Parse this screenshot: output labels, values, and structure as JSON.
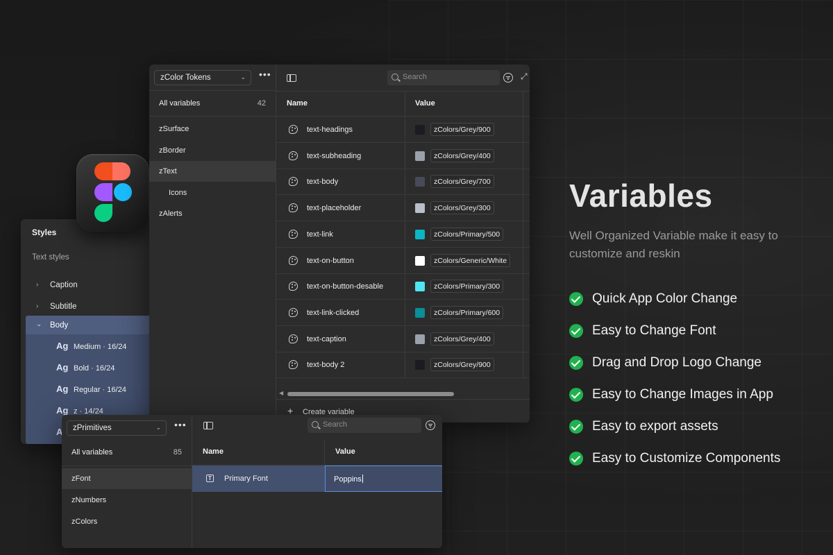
{
  "main_panel": {
    "collection": "zColor Tokens",
    "all_variables_label": "All variables",
    "all_variables_count": "42",
    "groups": [
      {
        "label": "zSurface",
        "active": false,
        "sub": false
      },
      {
        "label": "zBorder",
        "active": false,
        "sub": false
      },
      {
        "label": "zText",
        "active": true,
        "sub": false
      },
      {
        "label": "Icons",
        "active": false,
        "sub": true
      },
      {
        "label": "zAlerts",
        "active": false,
        "sub": false
      }
    ],
    "search_placeholder": "Search",
    "columns": {
      "name": "Name",
      "value": "Value"
    },
    "variables": [
      {
        "name": "text-headings",
        "swatch": "#1b1b22",
        "alias": "zColors/Grey/900"
      },
      {
        "name": "text-subheading",
        "swatch": "#9aa1ad",
        "alias": "zColors/Grey/400"
      },
      {
        "name": "text-body",
        "swatch": "#474b57",
        "alias": "zColors/Grey/700"
      },
      {
        "name": "text-placeholder",
        "swatch": "#b9bec8",
        "alias": "zColors/Grey/300"
      },
      {
        "name": "text-link",
        "swatch": "#0cb5c4",
        "alias": "zColors/Primary/500"
      },
      {
        "name": "text-on-button",
        "swatch": "#ffffff",
        "alias": "zColors/Generic/White"
      },
      {
        "name": "text-on-button-desable",
        "swatch": "#4fe6f3",
        "alias": "zColors/Primary/300"
      },
      {
        "name": "text-link-clicked",
        "swatch": "#0a8e97",
        "alias": "zColors/Primary/600"
      },
      {
        "name": "text-caption",
        "swatch": "#9aa1ad",
        "alias": "zColors/Grey/400"
      },
      {
        "name": "text-body 2",
        "swatch": "#1b1b22",
        "alias": "zColors/Grey/900"
      }
    ],
    "create_label": "Create variable"
  },
  "styles_panel": {
    "title": "Styles",
    "section": "Text styles",
    "groups": [
      {
        "label": "Caption"
      },
      {
        "label": "Subtitle"
      }
    ],
    "expanded": "Body",
    "text_styles": [
      {
        "ag": "Ag",
        "label": "Medium · 16/24"
      },
      {
        "ag": "Ag",
        "label": "Bold · 16/24"
      },
      {
        "ag": "Ag",
        "label": "Regular · 16/24"
      },
      {
        "ag": "Ag",
        "label": "z · 14/24"
      },
      {
        "ag": "A",
        "label": ""
      }
    ]
  },
  "primitives_panel": {
    "collection": "zPrimitives",
    "all_variables_label": "All variables",
    "all_variables_count": "85",
    "groups": [
      {
        "label": "zFont",
        "active": true
      },
      {
        "label": "zNumbers",
        "active": false
      },
      {
        "label": "zColors",
        "active": false
      }
    ],
    "search_placeholder": "Search",
    "columns": {
      "name": "Name",
      "value": "Value"
    },
    "row": {
      "name": "Primary Font",
      "value": "Poppins"
    }
  },
  "hero": {
    "title": "Variables",
    "subtitle": "Well Organized Variable make it easy to customize and reskin",
    "features": [
      "Quick App Color Change",
      "Easy to Change Font",
      "Drag and Drop Logo Change",
      "Easy to Change Images in App",
      "Easy to export assets",
      "Easy to Customize Components"
    ]
  },
  "colors": {
    "accent_blue": "#43506e",
    "check_green": "#21b14f",
    "logo_red": "#f24e1e",
    "logo_coral": "#ff7262",
    "logo_purple": "#a259ff",
    "logo_blue": "#1abcfe",
    "logo_green": "#0acf83"
  }
}
